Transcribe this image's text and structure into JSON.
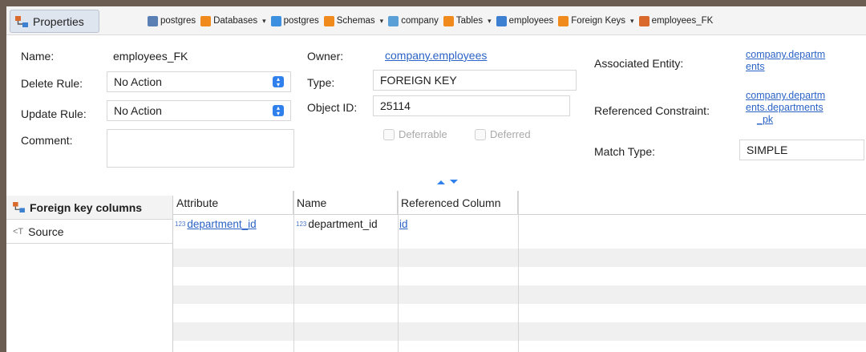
{
  "header": {
    "properties_tab": "Properties",
    "breadcrumbs": [
      {
        "label": "postgres",
        "icon": "database-server-icon",
        "color": "#5a7fb5",
        "caret": false
      },
      {
        "label": "Databases",
        "icon": "folder-icon",
        "color": "#f08a1c",
        "caret": true
      },
      {
        "label": "postgres",
        "icon": "database-icon",
        "color": "#3d8fe0",
        "caret": false
      },
      {
        "label": "Schemas",
        "icon": "schemas-folder-icon",
        "color": "#f08a1c",
        "caret": true
      },
      {
        "label": "company",
        "icon": "schema-icon",
        "color": "#5a9fd6",
        "caret": false
      },
      {
        "label": "Tables",
        "icon": "tables-folder-icon",
        "color": "#f08a1c",
        "caret": true
      },
      {
        "label": "employees",
        "icon": "table-icon",
        "color": "#3d7fd0",
        "caret": false
      },
      {
        "label": "Foreign Keys",
        "icon": "fk-folder-icon",
        "color": "#f08a1c",
        "caret": true
      },
      {
        "label": "employees_FK",
        "icon": "foreign-key-icon",
        "color": "#d96a2c",
        "caret": false
      }
    ]
  },
  "form": {
    "name_label": "Name:",
    "name_value": "employees_FK",
    "delete_rule_label": "Delete Rule:",
    "delete_rule_value": "No Action",
    "update_rule_label": "Update Rule:",
    "update_rule_value": "No Action",
    "comment_label": "Comment:",
    "comment_value": "",
    "owner_label": "Owner:",
    "owner_value": "company.employees",
    "type_label": "Type:",
    "type_value": "FOREIGN KEY",
    "object_id_label": "Object ID:",
    "object_id_value": "25114",
    "deferrable_label": "Deferrable",
    "deferred_label": "Deferred",
    "associated_entity_label": "Associated Entity:",
    "associated_entity_lines": [
      "company.departm",
      "ents"
    ],
    "referenced_constraint_label": "Referenced Constraint:",
    "referenced_constraint_lines": [
      "company.departm",
      "ents.departments",
      "_pk"
    ],
    "match_type_label": "Match Type:",
    "match_type_value": "SIMPLE"
  },
  "left_panel": {
    "items": [
      {
        "label": "Foreign key columns",
        "icon": "foreign-key-icon"
      },
      {
        "label": "Source",
        "icon": "source-icon"
      }
    ]
  },
  "grid": {
    "columns": [
      "Attribute",
      "Name",
      "Referenced Column"
    ],
    "rows": [
      {
        "type_badge": "123",
        "attribute": "department_id",
        "name_badge": "123",
        "name": "department_id",
        "referenced_column": "id"
      }
    ]
  }
}
